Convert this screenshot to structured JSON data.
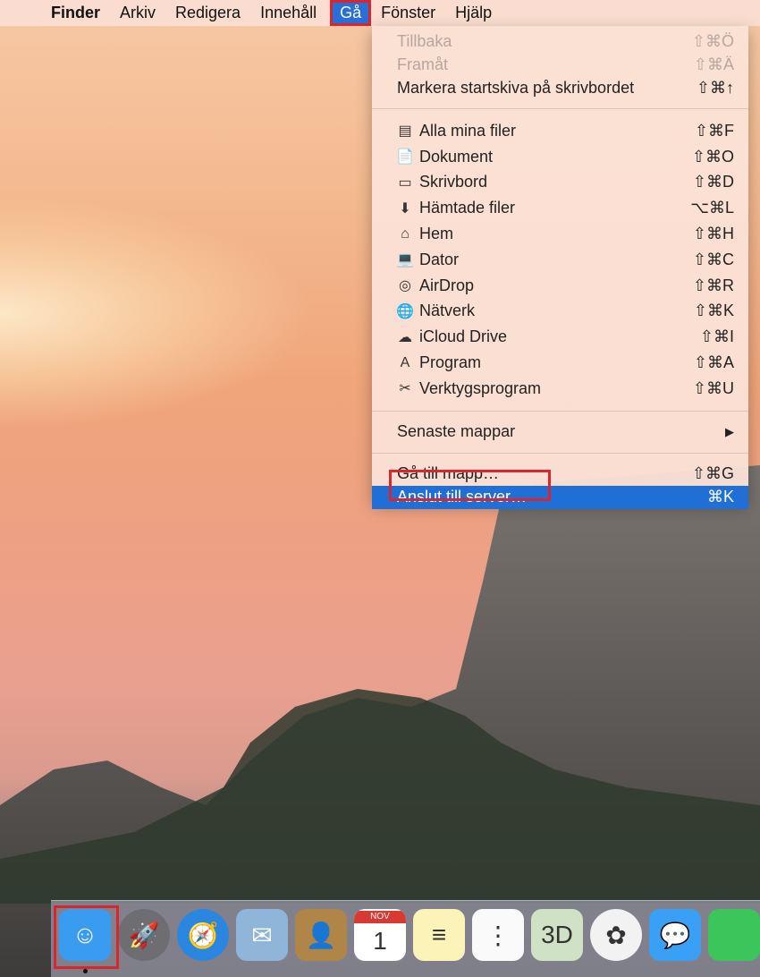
{
  "menubar": {
    "apple": "",
    "items": [
      "Finder",
      "Arkiv",
      "Redigera",
      "Innehåll",
      "Gå",
      "Fönster",
      "Hjälp"
    ]
  },
  "go_menu": {
    "nav": [
      {
        "label": "Tillbaka",
        "shortcut": "⇧⌘Ö",
        "disabled": true
      },
      {
        "label": "Framåt",
        "shortcut": "⇧⌘Ä",
        "disabled": true
      },
      {
        "label": "Markera startskiva på skrivbordet",
        "shortcut": "⇧⌘↑"
      }
    ],
    "places": [
      {
        "label": "Alla mina filer",
        "shortcut": "⇧⌘F",
        "icon": "all-files-icon"
      },
      {
        "label": "Dokument",
        "shortcut": "⇧⌘O",
        "icon": "documents-icon"
      },
      {
        "label": "Skrivbord",
        "shortcut": "⇧⌘D",
        "icon": "desktop-icon"
      },
      {
        "label": "Hämtade filer",
        "shortcut": "⌥⌘L",
        "icon": "downloads-icon"
      },
      {
        "label": "Hem",
        "shortcut": "⇧⌘H",
        "icon": "home-icon"
      },
      {
        "label": "Dator",
        "shortcut": "⇧⌘C",
        "icon": "computer-icon"
      },
      {
        "label": "AirDrop",
        "shortcut": "⇧⌘R",
        "icon": "airdrop-icon"
      },
      {
        "label": "Nätverk",
        "shortcut": "⇧⌘K",
        "icon": "network-icon"
      },
      {
        "label": "iCloud Drive",
        "shortcut": "⇧⌘I",
        "icon": "icloud-icon"
      },
      {
        "label": "Program",
        "shortcut": "⇧⌘A",
        "icon": "applications-icon"
      },
      {
        "label": "Verktygsprogram",
        "shortcut": "⇧⌘U",
        "icon": "utilities-icon"
      }
    ],
    "recent": {
      "label": "Senaste mappar",
      "arrow": "▶"
    },
    "goto": {
      "label": "Gå till mapp…",
      "shortcut": "⇧⌘G"
    },
    "connect": {
      "label": "Anslut till server…",
      "shortcut": "⌘K"
    }
  },
  "dock": {
    "items": [
      {
        "name": "finder",
        "glyph": "☺",
        "color": "#3a9cf0"
      },
      {
        "name": "launchpad",
        "glyph": "🚀",
        "color": "#6e6e72"
      },
      {
        "name": "safari",
        "glyph": "🧭",
        "color": "#2b86e0"
      },
      {
        "name": "mail",
        "glyph": "✉",
        "color": "#8fb6d8"
      },
      {
        "name": "contacts",
        "glyph": "👤",
        "color": "#b08548"
      },
      {
        "name": "calendar",
        "glyph": "1",
        "month": "NOV",
        "color": "#ffffff"
      },
      {
        "name": "notes",
        "glyph": "≡",
        "color": "#fbf3b8"
      },
      {
        "name": "reminders",
        "glyph": "⋮",
        "color": "#fafafa"
      },
      {
        "name": "maps",
        "glyph": "3D",
        "color": "#cfe2c5"
      },
      {
        "name": "photos",
        "glyph": "✿",
        "color": "#f2f2f2"
      },
      {
        "name": "messages",
        "glyph": "💬",
        "color": "#3aa0f5"
      },
      {
        "name": "facetime",
        "glyph": "",
        "color": "#3bc55a"
      }
    ]
  }
}
